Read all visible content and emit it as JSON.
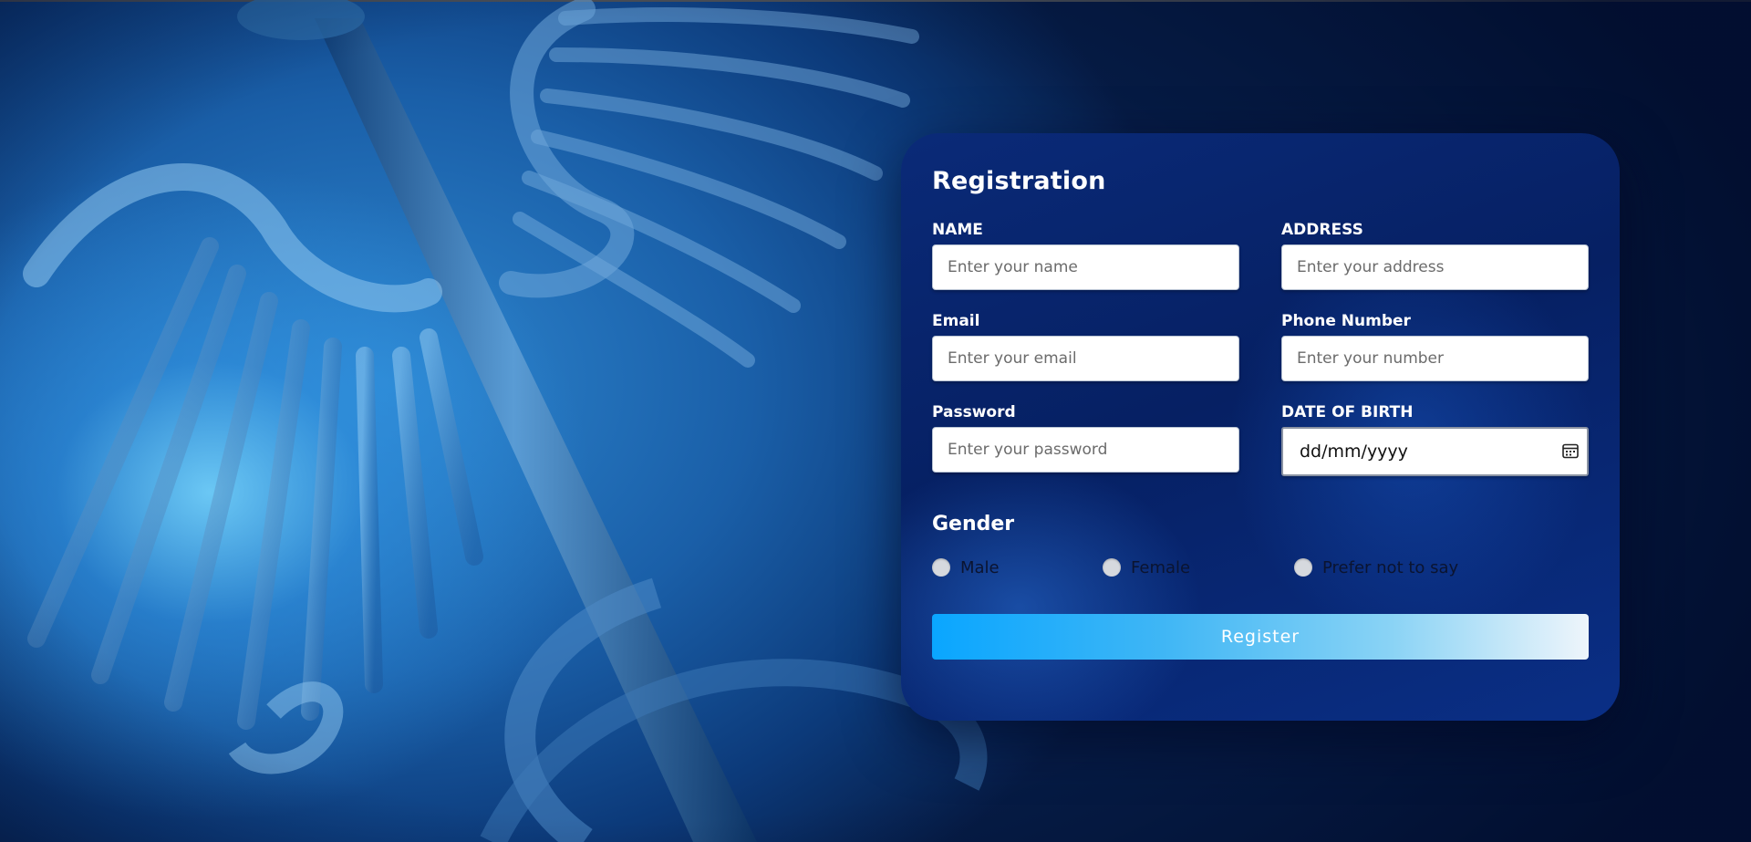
{
  "form": {
    "title": "Registration",
    "fields": {
      "name": {
        "label": "NAME",
        "placeholder": "Enter your name"
      },
      "address": {
        "label": "ADDRESS",
        "placeholder": "Enter your address"
      },
      "email": {
        "label": "Email",
        "placeholder": "Enter your email"
      },
      "phone": {
        "label": "Phone Number",
        "placeholder": "Enter your number"
      },
      "password": {
        "label": "Password",
        "placeholder": "Enter your password"
      },
      "dob": {
        "label": "DATE OF BIRTH",
        "value": "dd/mm/yyyy",
        "icon": "calendar-icon"
      }
    },
    "gender": {
      "title": "Gender",
      "options": [
        "Male",
        "Female",
        "Prefer not to say"
      ]
    },
    "register_label": "Register"
  },
  "colors": {
    "card_bg": "#062063",
    "button_start": "#0aa6ff",
    "button_end": "#eef5fb",
    "radio": "#d6d9de",
    "label_text": "#ffffff"
  },
  "background": {
    "image": "caduceus-medical-symbol"
  }
}
